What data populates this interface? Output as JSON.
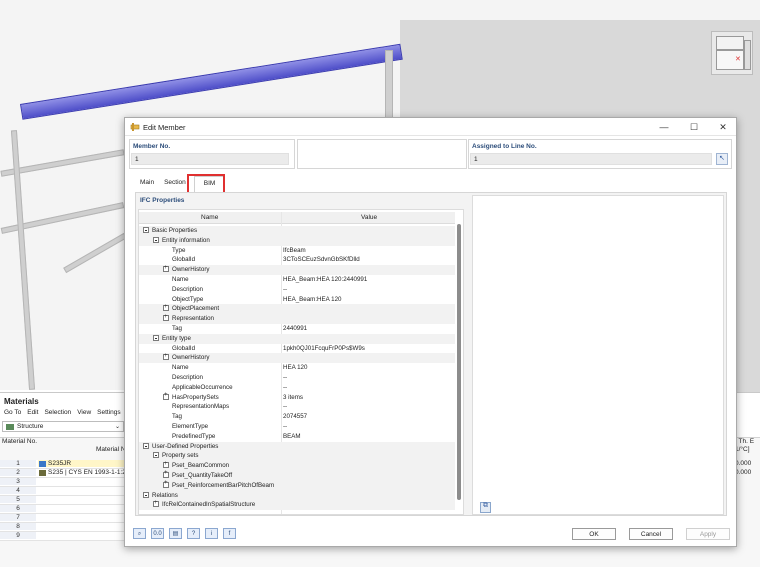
{
  "dialog": {
    "title": "Edit Member",
    "member_no_label": "Member No.",
    "member_no_value": "1",
    "assigned_label": "Assigned to Line No.",
    "assigned_value": "1",
    "tabs": [
      {
        "label": "Main"
      },
      {
        "label": "Section"
      },
      {
        "label": "BIM"
      }
    ],
    "active_tab": "BIM",
    "ifc_header": "IFC Properties",
    "columns": {
      "name": "Name",
      "value": "Value"
    },
    "rows": [
      {
        "level": 0,
        "box": "minus",
        "name": "Basic Properties",
        "value": "",
        "shade": true
      },
      {
        "level": 1,
        "box": "minus",
        "name": "Entity information",
        "value": "",
        "shade": true
      },
      {
        "level": 2,
        "box": "",
        "name": "Type",
        "value": "IfcBeam",
        "shade": false
      },
      {
        "level": 2,
        "box": "",
        "name": "GlobalId",
        "value": "3CToSCEuzSdvnGbSKfDlld",
        "shade": false
      },
      {
        "level": 2,
        "box": "plus",
        "name": "OwnerHistory",
        "value": "",
        "shade": true
      },
      {
        "level": 2,
        "box": "",
        "name": "Name",
        "value": "HEA_Beam:HEA 120:2440991",
        "shade": false
      },
      {
        "level": 2,
        "box": "",
        "name": "Description",
        "value": "--",
        "shade": false
      },
      {
        "level": 2,
        "box": "",
        "name": "ObjectType",
        "value": "HEA_Beam:HEA 120",
        "shade": false
      },
      {
        "level": 2,
        "box": "plus",
        "name": "ObjectPlacement",
        "value": "",
        "shade": true
      },
      {
        "level": 2,
        "box": "plus",
        "name": "Representation",
        "value": "",
        "shade": true
      },
      {
        "level": 2,
        "box": "",
        "name": "Tag",
        "value": "2440991",
        "shade": false
      },
      {
        "level": 1,
        "box": "minus",
        "name": "Entity type",
        "value": "",
        "shade": true
      },
      {
        "level": 2,
        "box": "",
        "name": "GlobalId",
        "value": "1pkh0QJ01FcquFrP0Ps$W9s",
        "shade": false
      },
      {
        "level": 2,
        "box": "plus",
        "name": "OwnerHistory",
        "value": "",
        "shade": true
      },
      {
        "level": 2,
        "box": "",
        "name": "Name",
        "value": "HEA 120",
        "shade": false
      },
      {
        "level": 2,
        "box": "",
        "name": "Description",
        "value": "--",
        "shade": false
      },
      {
        "level": 2,
        "box": "",
        "name": "ApplicableOccurrence",
        "value": "--",
        "shade": false
      },
      {
        "level": 2,
        "box": "plus",
        "name": "HasPropertySets",
        "value": "3 items",
        "shade": false
      },
      {
        "level": 2,
        "box": "",
        "name": "RepresentationMaps",
        "value": "--",
        "shade": false
      },
      {
        "level": 2,
        "box": "",
        "name": "Tag",
        "value": "2074557",
        "shade": false
      },
      {
        "level": 2,
        "box": "",
        "name": "ElementType",
        "value": "--",
        "shade": false
      },
      {
        "level": 2,
        "box": "",
        "name": "PredefinedType",
        "value": "BEAM",
        "shade": false
      },
      {
        "level": 0,
        "box": "minus",
        "name": "User-Defined Properties",
        "value": "",
        "shade": true
      },
      {
        "level": 1,
        "box": "minus",
        "name": "Property sets",
        "value": "",
        "shade": true
      },
      {
        "level": 2,
        "box": "plus",
        "name": "Pset_BeamCommon",
        "value": "",
        "shade": true
      },
      {
        "level": 2,
        "box": "plus",
        "name": "Pset_QuantityTakeOff",
        "value": "",
        "shade": true
      },
      {
        "level": 2,
        "box": "plus",
        "name": "Pset_ReinforcementBarPitchOfBeam",
        "value": "",
        "shade": true
      },
      {
        "level": 0,
        "box": "minus",
        "name": "Relations",
        "value": "",
        "shade": true
      },
      {
        "level": 1,
        "box": "plus",
        "name": "IfcRelContainedInSpatialStructure",
        "value": "",
        "shade": true
      }
    ],
    "buttons": {
      "ok": "OK",
      "cancel": "Cancel",
      "apply": "Apply"
    },
    "toolbar_icons": [
      "search-icon",
      "decimal-icon",
      "units-icon",
      "help-icon",
      "info-icon",
      "function-icon"
    ]
  },
  "materials": {
    "title": "Materials",
    "menu": [
      "Go To",
      "Edit",
      "Selection",
      "View",
      "Settings"
    ],
    "combo": "Structure",
    "header_no": "Material No.",
    "header_name": "Material N",
    "rows": [
      {
        "no": "1",
        "name": "S235JR",
        "color": "#3a78c8"
      },
      {
        "no": "2",
        "name": "S235 | CYS EN 1993-1-1:2",
        "color": "#6b6b3a"
      },
      {
        "no": "3",
        "name": "",
        "color": ""
      },
      {
        "no": "4",
        "name": "",
        "color": ""
      },
      {
        "no": "5",
        "name": "",
        "color": ""
      },
      {
        "no": "6",
        "name": "",
        "color": ""
      },
      {
        "no": "7",
        "name": "",
        "color": ""
      },
      {
        "no": "8",
        "name": "",
        "color": ""
      },
      {
        "no": "9",
        "name": "",
        "color": ""
      }
    ],
    "right_header": "t Th. E",
    "right_unit": "1/°C]",
    "right_values": [
      "0.000",
      "0.000"
    ]
  }
}
